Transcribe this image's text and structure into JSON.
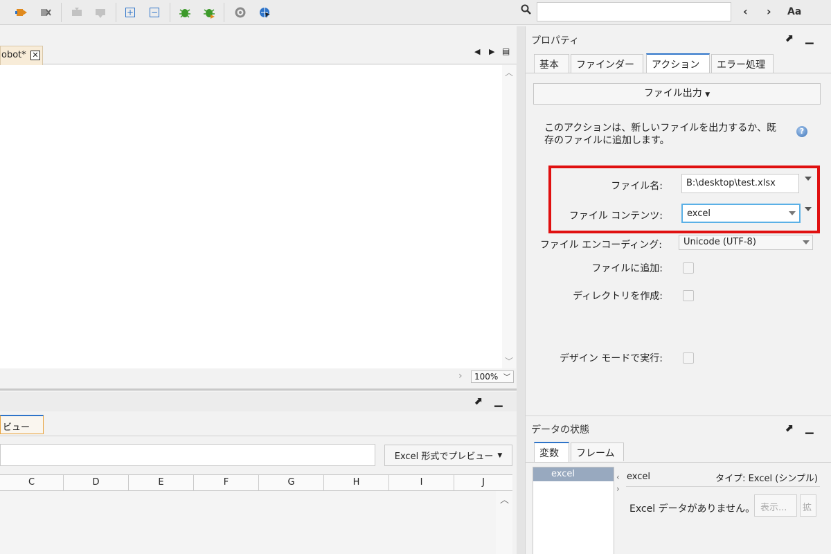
{
  "toolbar": {
    "icons": [
      "run-to-icon",
      "stop-icon",
      "step-back-icon",
      "step-forward-icon",
      "expand-icon",
      "collapse-icon",
      "debug-icon",
      "debug-step-icon",
      "settings-icon",
      "globe-icon"
    ]
  },
  "search": {
    "value": "",
    "placeholder": "",
    "prev_glyph": "‹",
    "next_glyph": "›",
    "match_case_label": "Aa"
  },
  "editor": {
    "tab_label": "obot*",
    "zoom": "100%"
  },
  "preview": {
    "tab_label": "ビュー",
    "excel_button_label": "Excel 形式でプレビュー",
    "columns": [
      "C",
      "D",
      "E",
      "F",
      "G",
      "H",
      "I",
      "J"
    ]
  },
  "properties": {
    "title": "プロパティ",
    "tabs": [
      "基本",
      "ファインダー",
      "アクション",
      "エラー処理"
    ],
    "active_tab": "アクション",
    "action_label": "ファイル出力",
    "description": "このアクションは、新しいファイルを出力するか、既存のファイルに追加します。",
    "help_glyph": "?",
    "fields": {
      "file_name_label": "ファイル名:",
      "file_name_value": "B:\\desktop\\test.xlsx",
      "file_content_label": "ファイル コンテンツ:",
      "file_content_value": "excel",
      "encoding_label": "ファイル エンコーディング:",
      "encoding_value": "Unicode (UTF-8)",
      "append_label": "ファイルに追加:",
      "mkdir_label": "ディレクトリを作成:",
      "design_mode_label": "デザイン モードで実行:"
    },
    "highlight_color": "#e01010"
  },
  "data_state": {
    "title": "データの状態",
    "tabs": [
      "変数",
      "フレーム"
    ],
    "active_tab": "変数",
    "variables": [
      "excel"
    ],
    "selected_variable": "excel",
    "type_label": "タイプ: Excel (シンプル)",
    "no_data_text": "Excel データがありません。",
    "show_button": "表示...",
    "expand_button": "拡"
  },
  "colors": {
    "accent": "#2e74c9",
    "focus": "#5ab0e6"
  }
}
